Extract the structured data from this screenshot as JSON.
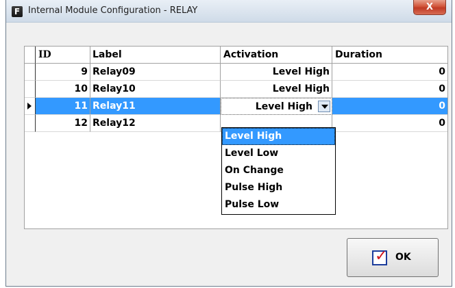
{
  "window": {
    "title": "Internal Module Configuration - RELAY",
    "app_icon": "F",
    "close_label": "X"
  },
  "grid": {
    "columns": [
      "ID",
      "Label",
      "Activation",
      "Duration"
    ],
    "rows": [
      {
        "id": "9",
        "label": "Relay09",
        "activation": "Level High",
        "duration": "0"
      },
      {
        "id": "10",
        "label": "Relay10",
        "activation": "Level High",
        "duration": "0"
      },
      {
        "id": "11",
        "label": "Relay11",
        "activation": "Level High",
        "duration": "0"
      },
      {
        "id": "12",
        "label": "Relay12",
        "activation": "",
        "duration": "0"
      }
    ],
    "selected_row": 2
  },
  "dropdown": {
    "options": [
      "Level High",
      "Level Low",
      "On Change",
      "Pulse High",
      "Pulse Low"
    ],
    "highlighted": "Level High"
  },
  "ok_button": {
    "label": "OK",
    "icon": "checkbox-check-icon"
  },
  "colors": {
    "selection": "#3399ff",
    "close_button": "#c9452f"
  }
}
